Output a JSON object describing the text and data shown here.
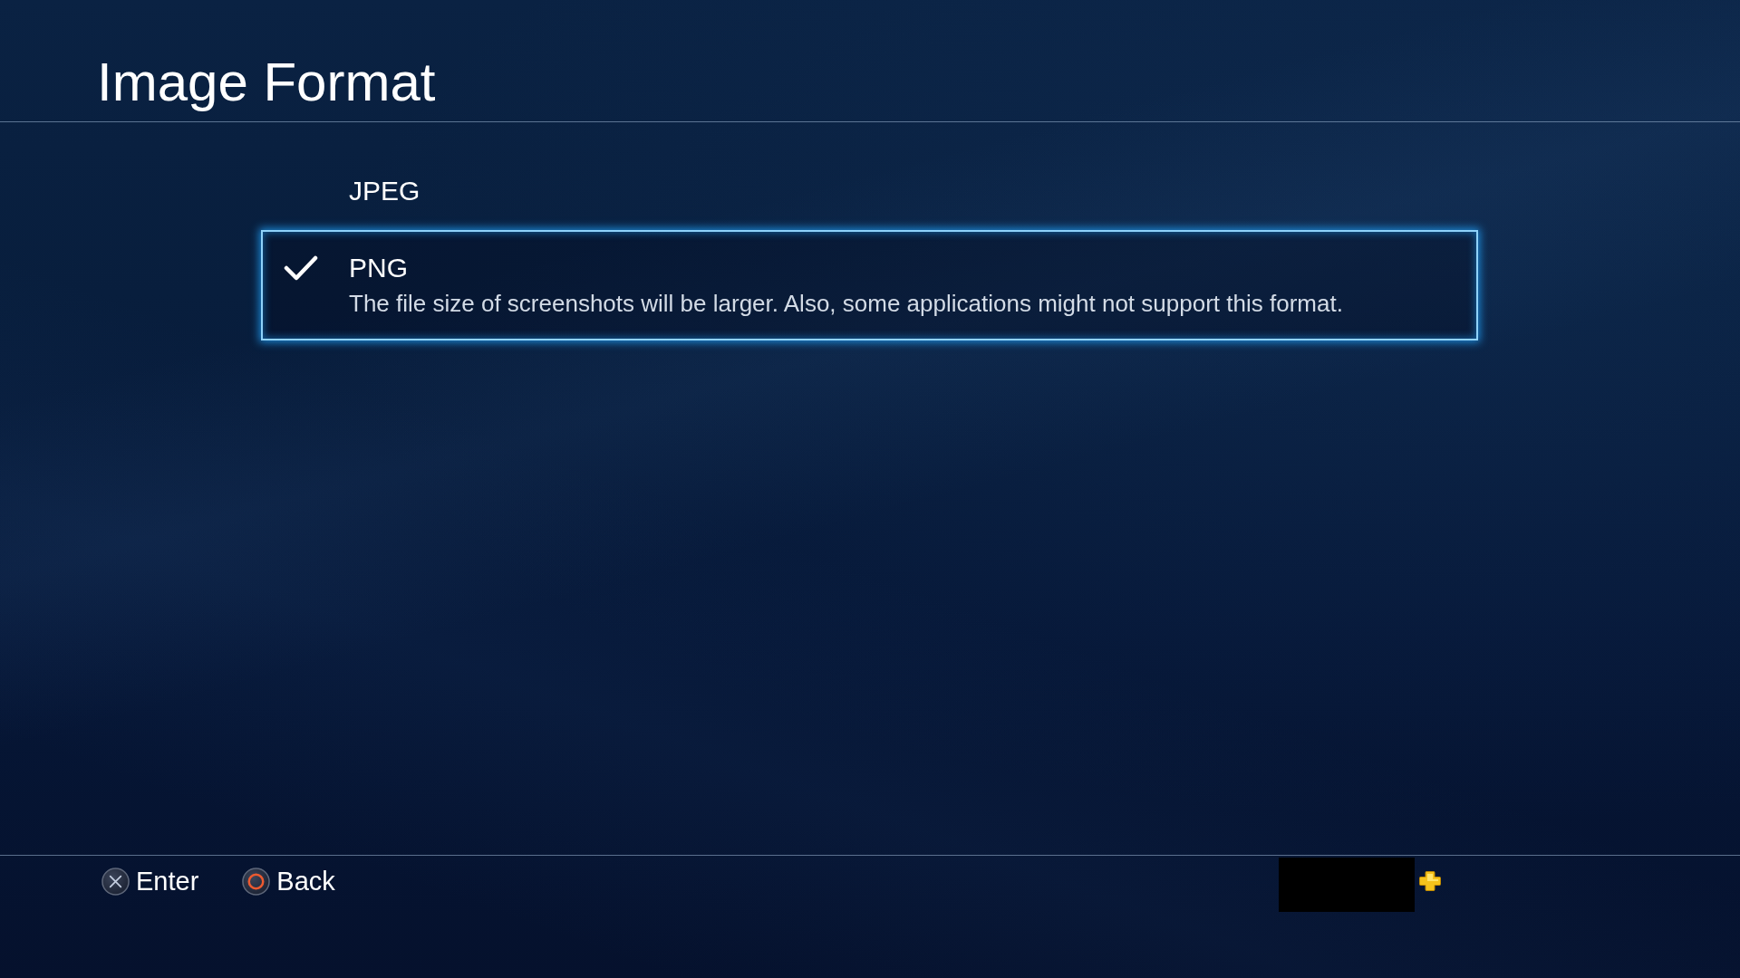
{
  "header": {
    "title": "Image Format"
  },
  "options": [
    {
      "label": "JPEG",
      "selected": false,
      "focused": false
    },
    {
      "label": "PNG",
      "description": "The file size of screenshots will be larger. Also, some applications might not support this format.",
      "selected": true,
      "focused": true
    }
  ],
  "footer": {
    "hints": [
      {
        "kind": "cross",
        "label": "Enter"
      },
      {
        "kind": "circle",
        "label": "Back"
      }
    ],
    "account": {
      "plus": true
    }
  }
}
